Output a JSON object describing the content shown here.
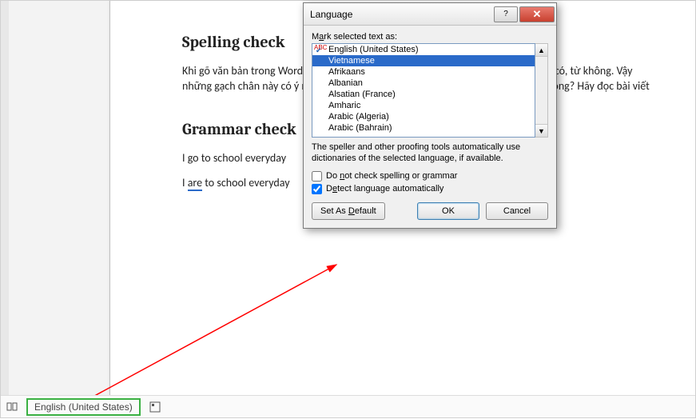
{
  "document": {
    "heading1": "Spelling check",
    "para1": "Khi gõ văn bản trong Word, các gạch chân xanh đỏ hiện lên bên dưới các từ, có từ có, từ không. Vậy những gạch chân này có ý nghĩa gì, sử dụng trong Word, và bỏ có ảnh hưởng gì không? Hãy đọc bài viết",
    "heading2": "Grammar check",
    "para2": "I go to school everyday",
    "para3_prefix": "I ",
    "para3_err": "are",
    "para3_suffix": " to school everyday"
  },
  "dialog": {
    "title": "Language",
    "mark_label": "Mark selected text as:",
    "items": [
      {
        "label": "English (United States)",
        "checked": true,
        "selected": false
      },
      {
        "label": "Vietnamese",
        "checked": false,
        "selected": true
      },
      {
        "label": "Afrikaans",
        "checked": false,
        "selected": false
      },
      {
        "label": "Albanian",
        "checked": false,
        "selected": false
      },
      {
        "label": "Alsatian (France)",
        "checked": false,
        "selected": false
      },
      {
        "label": "Amharic",
        "checked": false,
        "selected": false
      },
      {
        "label": "Arabic (Algeria)",
        "checked": false,
        "selected": false
      },
      {
        "label": "Arabic (Bahrain)",
        "checked": false,
        "selected": false
      }
    ],
    "note": "The speller and other proofing tools automatically use dictionaries of the selected language, if available.",
    "chk_nocheck": "Do not check spelling or grammar",
    "chk_detect": "Detect language automatically",
    "chk_nocheck_val": false,
    "chk_detect_val": true,
    "btn_default": "Set As Default",
    "btn_ok": "OK",
    "btn_cancel": "Cancel"
  },
  "statusbar": {
    "language": "English (United States)"
  }
}
